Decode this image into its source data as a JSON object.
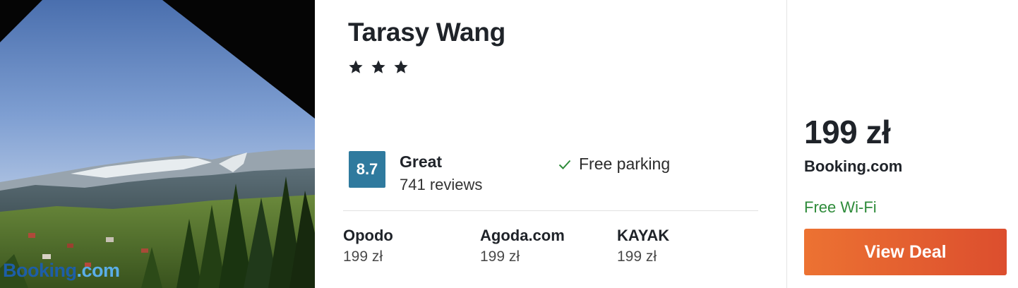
{
  "hotel": {
    "name": "Tarasy Wang",
    "star_count": 3,
    "rating": {
      "score": "8.7",
      "label": "Great",
      "reviews": "741 reviews",
      "color": "#2f7a9e"
    },
    "amenity": {
      "label": "Free parking",
      "icon": "checkmark-icon"
    },
    "photo": {
      "watermark_part1": "Booking",
      "watermark_part2": ".com"
    }
  },
  "providers": [
    {
      "name": "Opodo",
      "price": "199 zł"
    },
    {
      "name": "Agoda.com",
      "price": "199 zł"
    },
    {
      "name": "KAYAK",
      "price": "199 zł"
    }
  ],
  "deal": {
    "price": "199 zł",
    "provider": "Booking.com",
    "amenity": "Free Wi-Fi",
    "amenity_color": "#2e8b3a",
    "button_label": "View Deal",
    "button_color": "#e45f30"
  }
}
